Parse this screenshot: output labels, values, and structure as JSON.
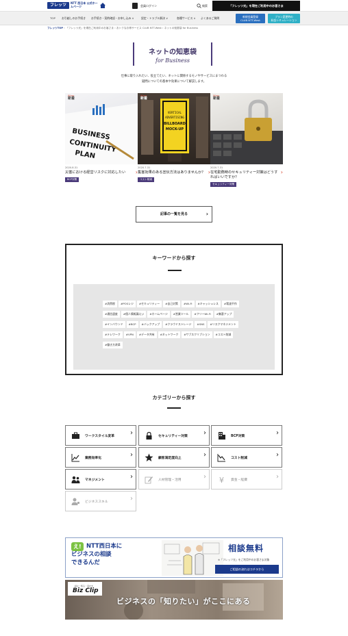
{
  "header": {
    "logo_mark": "フレッツ",
    "logo_text": "NTT 西日本 公式ホームページ",
    "login_label": "会員ログイン",
    "search_label": "検索",
    "flets_banner": "「フレッツ光」を現在ご利用中のお客さま"
  },
  "nav": {
    "items": [
      "TOP",
      "お引越しのお手続き",
      "お手続き・契約確認・お申し込み ∨",
      "設定・トラブル解決 ∨",
      "各種サービス ∨",
      "よくあるご質問"
    ],
    "btn_clubntt": "新規会員登録\nCLUB NTT-West",
    "btn_plan": "プラン変更時の\n料金シミュレーション"
  },
  "breadcrumb": {
    "home": "フレッツTOP",
    "items": [
      "「フレッツ光」を現在ご利用中のお客さま",
      "おトクなお得サービス CLUB NTT-West",
      "ネットの知恵袋 for Business"
    ]
  },
  "title": {
    "main": "ネットの知恵袋",
    "sub": "for Business"
  },
  "intro": "仕事に取り入れたい、役立てたい、ネットに関係するモノやサービスにまつわる\n疑問についての基本や効果について解説します。",
  "new_label": {
    "en": "New",
    "ja": "新着"
  },
  "articles": [
    {
      "date": "2020.8.31",
      "title": "災害における経営リスクに対応したい",
      "tag": "BCP対策",
      "thumb_text": "BUSINESS CONTINUITY PLAN"
    },
    {
      "date": "2020.7.31",
      "title": "集客効果のある宣伝方法はありませんか？",
      "tag": "コスト削減",
      "thumb_text": "VERTICAL ADVERTISING BILLBOARD MOCK-UP"
    },
    {
      "date": "2020.7.31",
      "title": "在宅勤務時のセキュリティー対策はどうすればいいですか？",
      "tag": "セキュリティー対策",
      "thumb_text": ""
    }
  ],
  "list_button": "記事の一覧を見る",
  "keywords": {
    "title": "キーワードから探す",
    "tags": [
      "#消費税",
      "#POSレジ",
      "#セキュリティー",
      "#自己対策",
      "#Wi-Fi",
      "#キャッシュレス",
      "#電波不作",
      "#通信速度",
      "#個人情報漏えい",
      "#ホームページ",
      "#営業ツール",
      "#フリーWi-Fi",
      "#集客アップ",
      "#インバウンド",
      "#BCP",
      "#バックアップ",
      "#クラウドストレージ",
      "#SNS",
      "#リスクマネジメント",
      "#テレワーク",
      "#VPN",
      "#データ共有",
      "#ネットワーク",
      "#サブスクリプション",
      "#コスト削減",
      "#働き方改革"
    ]
  },
  "categories": {
    "title": "カテゴリーから探す",
    "items": [
      {
        "label": "ワークスタイル変革",
        "icon": "briefcase-icon",
        "active": true
      },
      {
        "label": "セキュリティー対策",
        "icon": "lock-icon",
        "active": true
      },
      {
        "label": "BCP対策",
        "icon": "building-icon",
        "active": true
      },
      {
        "label": "業務効率化",
        "icon": "chart-icon",
        "active": true
      },
      {
        "label": "顧客満足度向上",
        "icon": "star-icon",
        "active": true
      },
      {
        "label": "コスト削減",
        "icon": "cost-chart-icon",
        "active": true
      },
      {
        "label": "マネジメント",
        "icon": "people-icon",
        "active": true
      },
      {
        "label": "人材管理・活用",
        "icon": "pen-icon",
        "active": false
      },
      {
        "label": "資金・経費",
        "icon": "yen-icon",
        "active": false
      },
      {
        "label": "ビジネススキル",
        "icon": "person-icon",
        "active": false
      }
    ]
  },
  "banner_consult": {
    "bubble": "え!",
    "head_line1": "NTT西日本に",
    "head_line2": "ビジネスの相談",
    "head_line3": "できるんだ",
    "consult": "相談無料",
    "note": "※「フレッツ光」をご利用中のお客さま対象",
    "button": "ご相談の流れはコチラから"
  },
  "banner_bizclip": {
    "small": "読む・知る・活かす",
    "name": "Biz Clip",
    "catch": "ビジネスの「知りたい」がここにある"
  },
  "colors": {
    "brand_navy": "#1b3a8c",
    "accent_purple": "#4a3a7a",
    "new_red": "#d4412a"
  }
}
